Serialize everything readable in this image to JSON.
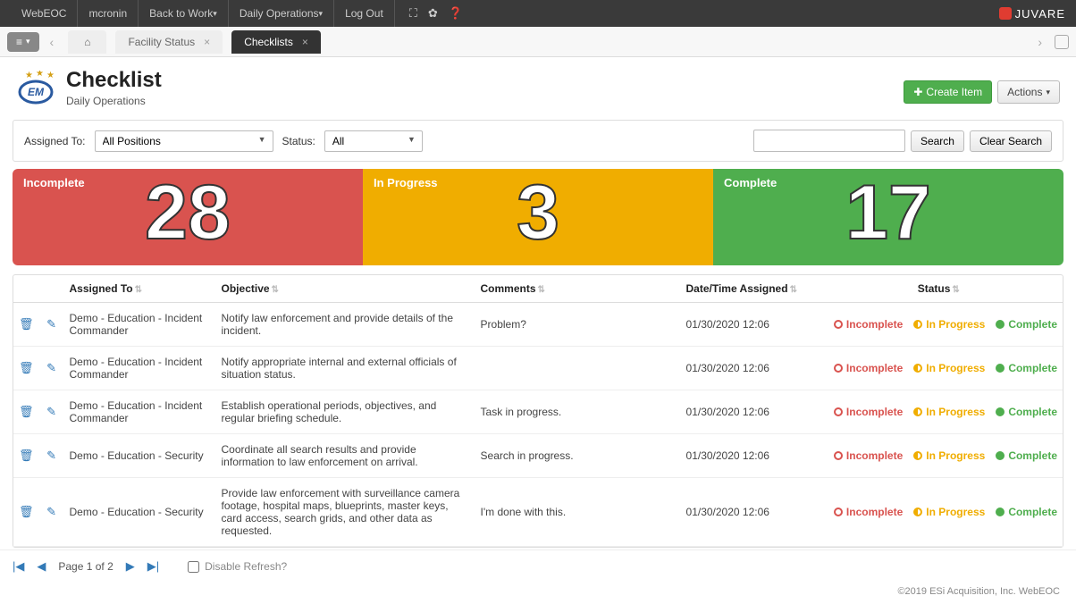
{
  "topbar": {
    "app": "WebEOC",
    "user": "mcronin",
    "menus": [
      "Back to Work",
      "Daily Operations"
    ],
    "logout": "Log Out",
    "brand": "JUVARE"
  },
  "tabs": {
    "facility": "Facility Status",
    "checklists": "Checklists"
  },
  "header": {
    "title": "Checklist",
    "subtitle": "Daily Operations",
    "create": "Create Item",
    "actions": "Actions"
  },
  "filters": {
    "assigned_label": "Assigned To:",
    "assigned_value": "All Positions",
    "status_label": "Status:",
    "status_value": "All",
    "search_btn": "Search",
    "clear_btn": "Clear Search"
  },
  "stats": {
    "incomplete_label": "Incomplete",
    "incomplete_value": "28",
    "inprogress_label": "In Progress",
    "inprogress_value": "3",
    "complete_label": "Complete",
    "complete_value": "17"
  },
  "cols": {
    "assigned": "Assigned To",
    "objective": "Objective",
    "comments": "Comments",
    "date": "Date/Time Assigned",
    "status": "Status"
  },
  "status_labels": {
    "incomplete": "Incomplete",
    "inprogress": "In Progress",
    "complete": "Complete"
  },
  "rows": [
    {
      "assigned": "Demo - Education - Incident Commander",
      "objective": "Notify law enforcement and provide details of the incident.",
      "comments": "Problem?",
      "date": "01/30/2020 12:06",
      "status": "inprogress"
    },
    {
      "assigned": "Demo - Education - Incident Commander",
      "objective": "Notify appropriate internal and external officials of situation status.",
      "comments": "",
      "date": "01/30/2020 12:06",
      "status": "incomplete"
    },
    {
      "assigned": "Demo - Education - Incident Commander",
      "objective": "Establish operational periods, objectives, and regular briefing schedule.",
      "comments": "Task in progress.",
      "date": "01/30/2020 12:06",
      "status": "inprogress"
    },
    {
      "assigned": "Demo - Education - Security",
      "objective": "Coordinate all search results and provide information to law enforcement on arrival.",
      "comments": "Search in progress.",
      "date": "01/30/2020 12:06",
      "status": "complete"
    },
    {
      "assigned": "Demo - Education - Security",
      "objective": "Provide law enforcement with surveillance camera footage, hospital maps, blueprints, master keys, card access, search grids, and other data as requested.",
      "comments": "I'm done with this.",
      "date": "01/30/2020 12:06",
      "status": "complete"
    }
  ],
  "pager": {
    "text": "Page 1 of 2",
    "disable_refresh": "Disable Refresh?"
  },
  "footer": "©2019 ESi Acquisition, Inc. WebEOC"
}
